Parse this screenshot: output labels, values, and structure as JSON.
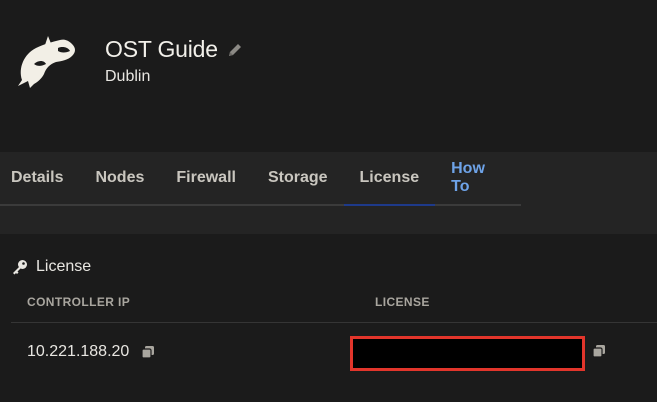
{
  "header": {
    "title": "OST Guide",
    "location": "Dublin",
    "logo_icon": "orca-icon",
    "edit_icon": "pencil-icon"
  },
  "tabs": [
    {
      "label": "Details",
      "active": false
    },
    {
      "label": "Nodes",
      "active": false
    },
    {
      "label": "Firewall",
      "active": false
    },
    {
      "label": "Storage",
      "active": false
    },
    {
      "label": "License",
      "active": true
    },
    {
      "label": "How To",
      "active": false,
      "color": "#6ea3e8"
    }
  ],
  "license_section": {
    "title": "License",
    "icon": "key-icon",
    "columns": [
      "CONTROLLER IP",
      "LICENSE"
    ],
    "rows": [
      {
        "controller_ip": "10.221.188.20",
        "license": ""
      }
    ]
  },
  "colors": {
    "background": "#1b1b1b",
    "tab_bar": "#242424",
    "active_tab_underline": "#1e3a8a",
    "redaction_border": "#e2352b"
  }
}
